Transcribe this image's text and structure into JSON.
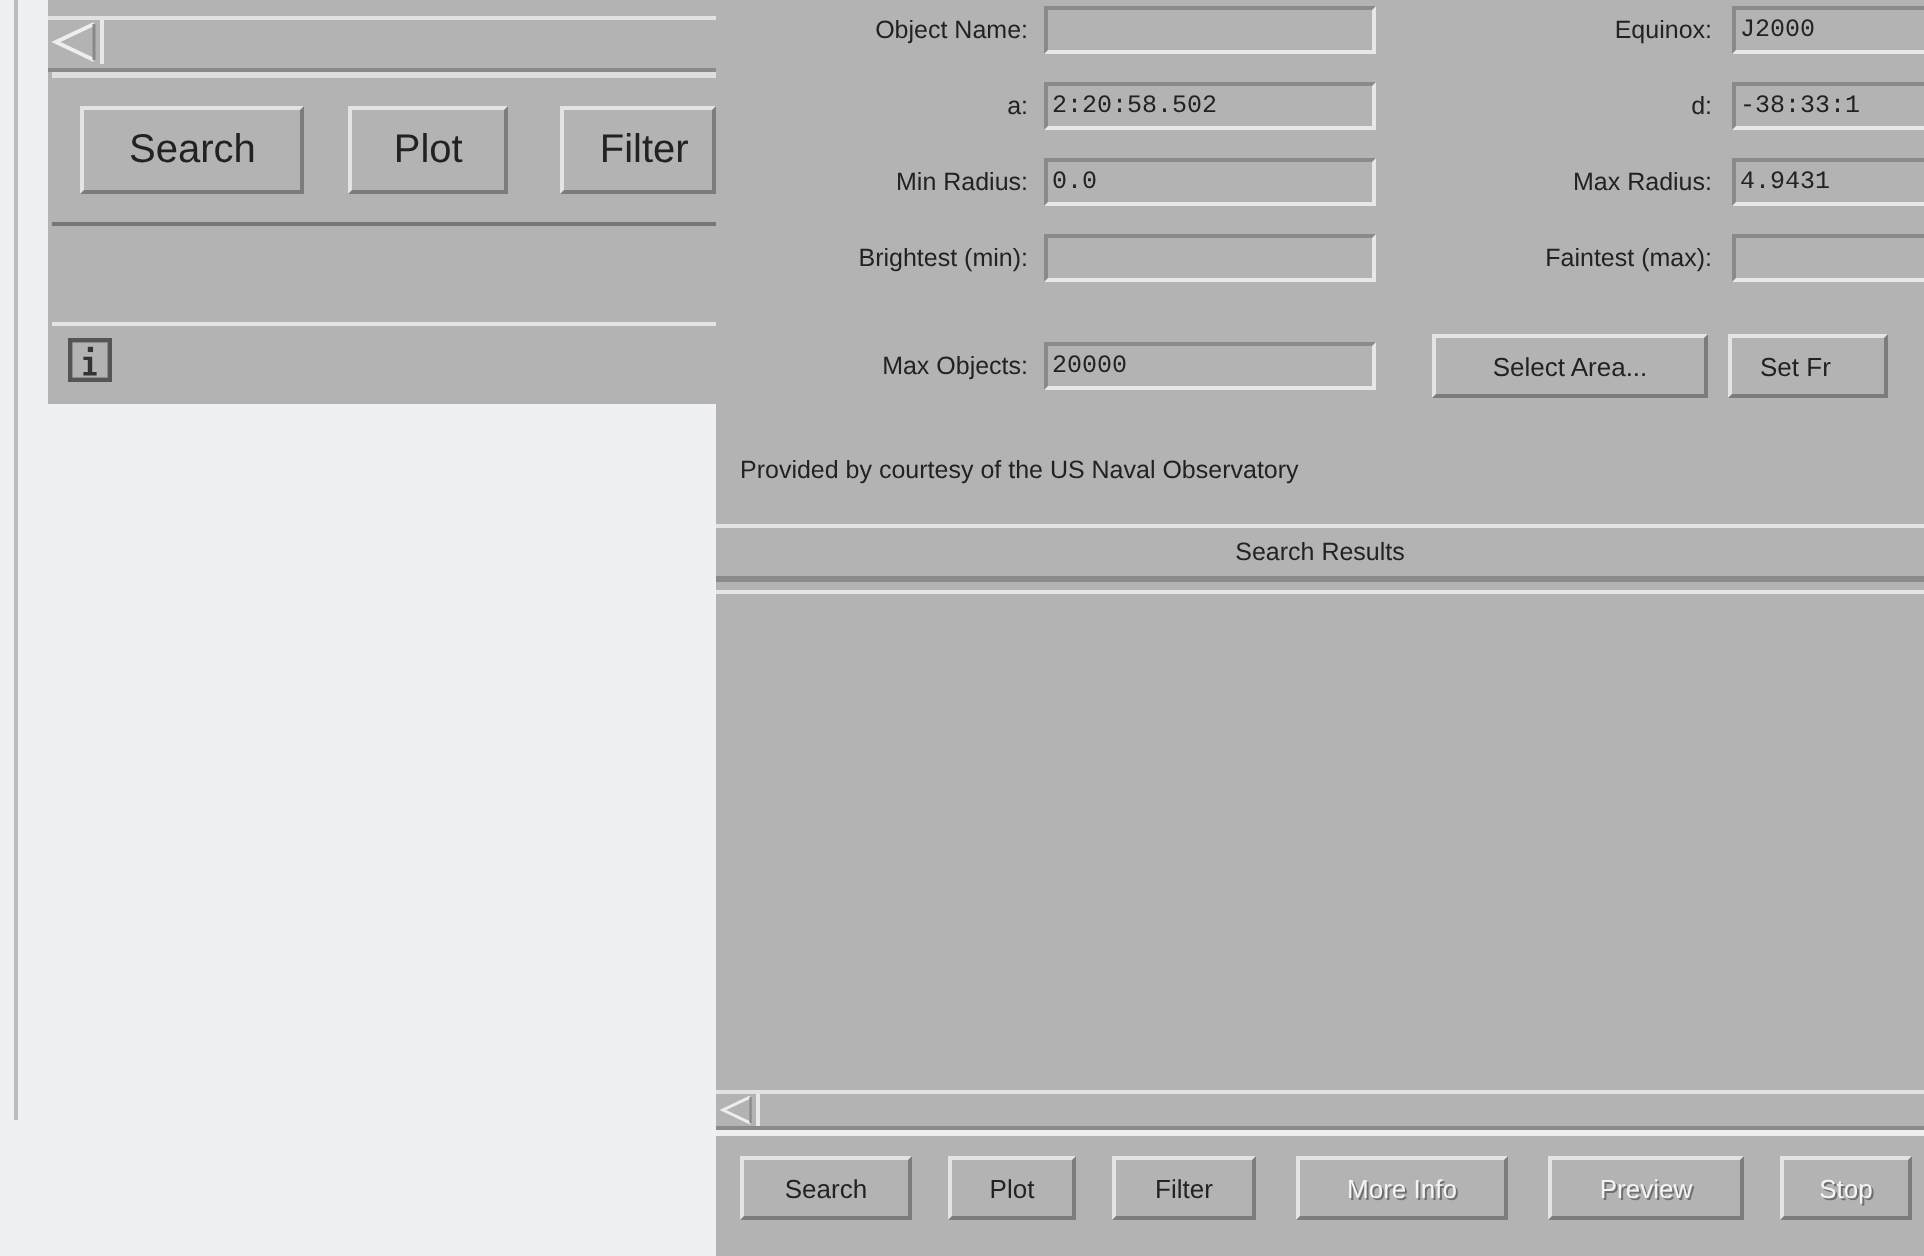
{
  "back_window": {
    "buttons": [
      {
        "label": "Search",
        "disabled": false
      },
      {
        "label": "Plot",
        "disabled": false
      },
      {
        "label": "Filter",
        "disabled": false
      }
    ]
  },
  "catalog_window": {
    "fields": [
      {
        "label": "Object Name:"
      },
      {
        "label": "Equinox:",
        "value": "J2000"
      },
      {
        "label": "a:",
        "value": "2:20:58.502"
      },
      {
        "label": "d:",
        "value": "-38:33:1"
      },
      {
        "label": "Min Radius:",
        "value": "0.0"
      },
      {
        "label": "Max Radius:",
        "value": "4.9431"
      },
      {
        "label": "Brightest (min):"
      },
      {
        "label": "Faintest (max):"
      },
      {
        "label": "Max Objects:",
        "value": "20000"
      }
    ],
    "area_buttons": [
      "Select Area...",
      "Set Fr"
    ],
    "credit": "Provided by courtesy of the US Naval Observatory",
    "results_title": "Search Results",
    "buttons": [
      {
        "label": "Search",
        "disabled": false
      },
      {
        "label": "Plot",
        "disabled": false
      },
      {
        "label": "Filter",
        "disabled": false
      },
      {
        "label": "More Info",
        "disabled": true
      },
      {
        "label": "Preview",
        "disabled": true
      },
      {
        "label": "Stop",
        "disabled": true
      }
    ]
  }
}
